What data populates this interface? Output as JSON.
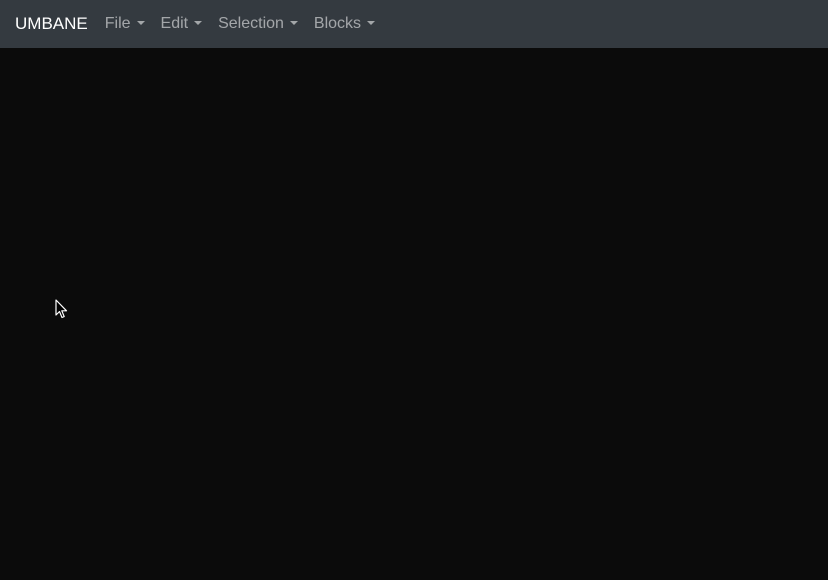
{
  "app": {
    "brand": "UMBANE"
  },
  "menubar": {
    "items": [
      {
        "label": "File"
      },
      {
        "label": "Edit"
      },
      {
        "label": "Selection"
      },
      {
        "label": "Blocks"
      }
    ]
  },
  "icons": {
    "caret": "chevron-down-icon",
    "pointer": "mouse-cursor-icon"
  },
  "colors": {
    "navbar_bg": "#343a40",
    "canvas_bg": "#0b0b0b",
    "brand_text": "#ffffff",
    "menu_text": "#9a9da0"
  }
}
